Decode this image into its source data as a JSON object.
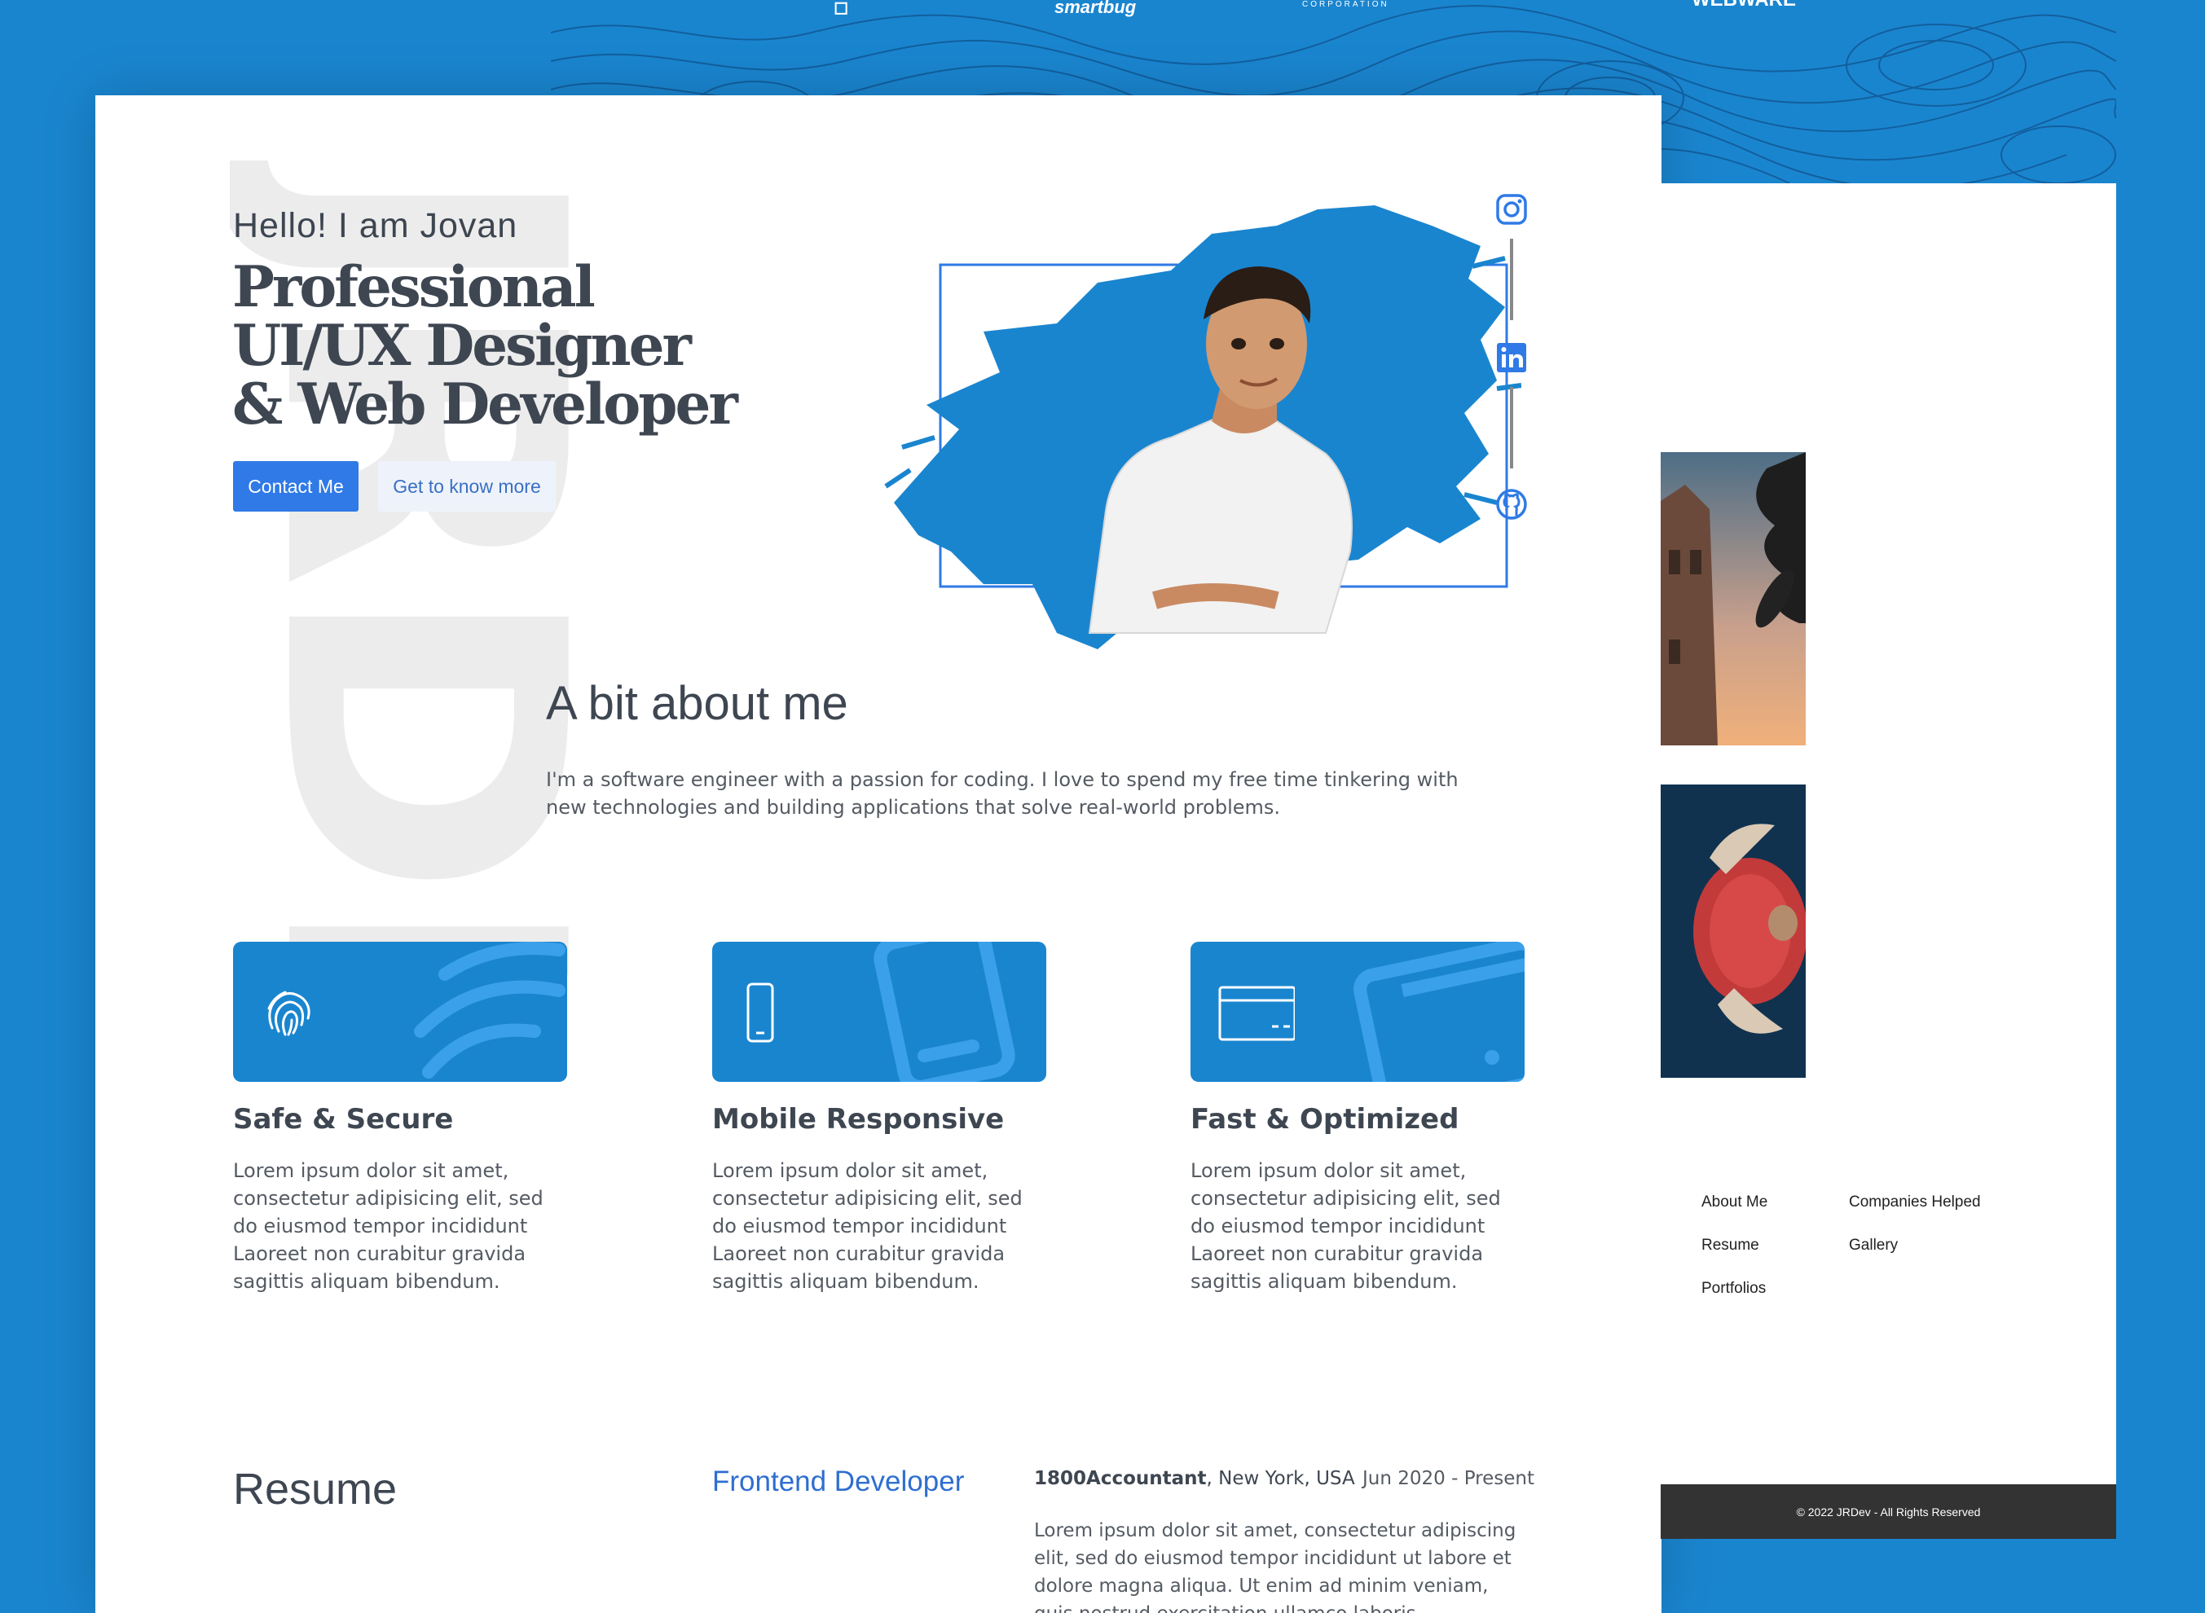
{
  "colors": {
    "brand_blue": "#1a85cf",
    "button_blue": "#2f7ae6",
    "text_dark": "#3e4651",
    "footer_bg": "#333333"
  },
  "top_logos": {
    "left": "smartbug",
    "middle": "CORPORATION",
    "right": "WEBWARE"
  },
  "hero": {
    "watermark": "JRDEV",
    "greeting": "Hello! I am Jovan",
    "headline_lines": [
      "Professional",
      "UI/UX Designer",
      "& Web Developer"
    ],
    "contact_label": "Contact Me",
    "more_label": "Get to know more"
  },
  "social": {
    "icons": [
      "instagram-icon",
      "linkedin-icon",
      "github-icon"
    ]
  },
  "about": {
    "title": "A bit about me",
    "text": "I'm a software engineer with a passion for coding. I love to spend my free time tinkering with new technologies and building applications that solve real-world problems."
  },
  "features": [
    {
      "icon": "fingerprint-icon",
      "title": "Safe & Secure",
      "text": "Lorem ipsum dolor sit amet, consectetur adipisicing elit, sed do eiusmod tempor incididunt Laoreet non curabitur gravida sagittis aliquam bibendum."
    },
    {
      "icon": "mobile-icon",
      "title": "Mobile Responsive",
      "text": "Lorem ipsum dolor sit amet, consectetur adipisicing elit, sed do eiusmod tempor incididunt Laoreet non curabitur gravida sagittis aliquam bibendum."
    },
    {
      "icon": "credit-card-icon",
      "title": "Fast & Optimized",
      "text": "Lorem ipsum dolor sit amet, consectetur adipisicing elit, sed do eiusmod tempor incididunt Laoreet non curabitur gravida sagittis aliquam bibendum."
    }
  ],
  "resume": {
    "title": "Resume",
    "job_title": "Frontend Developer",
    "company": "1800Accountant",
    "location": ", New York, USA",
    "dates": "Jun 2020 - Present",
    "description": "Lorem ipsum dolor sit amet, consectetur adipiscing elit, sed do eiusmod tempor incididunt ut labore et dolore magna aliqua. Ut enim ad minim veniam, quis nostrud exercitation ullamco laboris"
  },
  "side_panel": {
    "nav": [
      "About Me",
      "Companies Helped",
      "Resume",
      "Gallery",
      "Portfolios"
    ],
    "footer": "© 2022 JRDev - All Rights Reserved"
  }
}
